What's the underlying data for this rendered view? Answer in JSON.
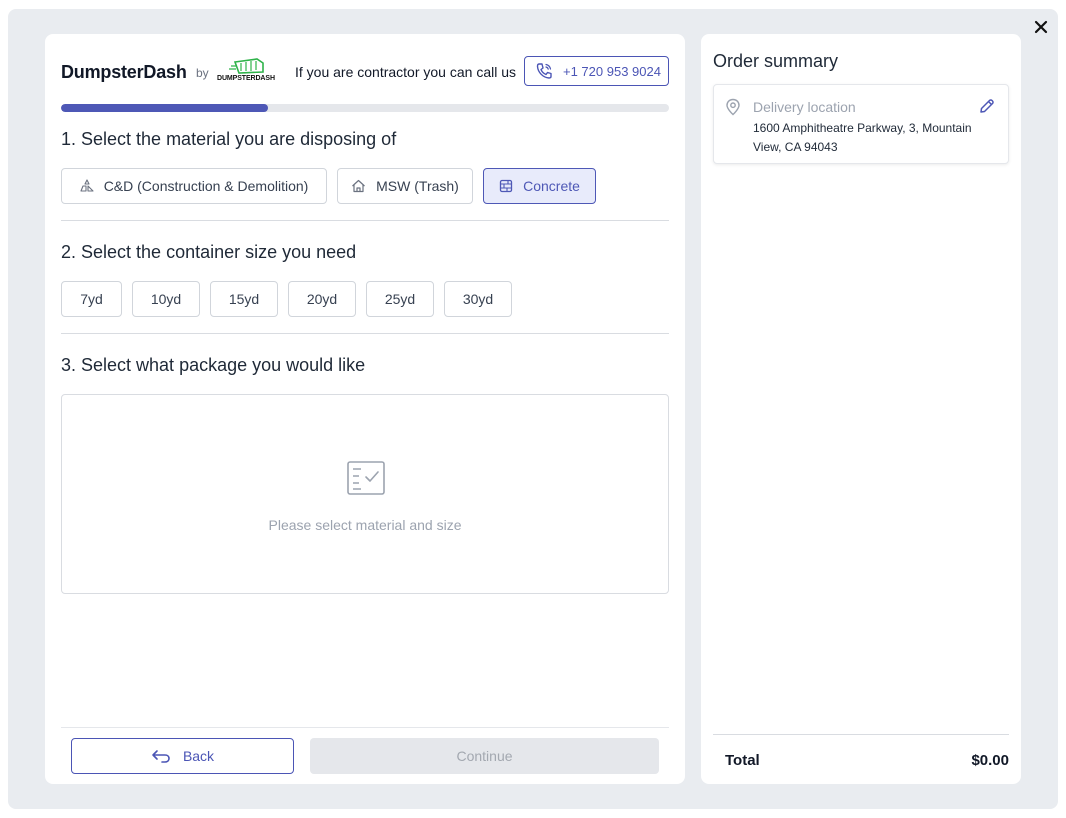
{
  "header": {
    "brand": "DumpsterDash",
    "by": "by",
    "logo_text": "DUMPSTERDASH",
    "contractor_text": "If you are contractor you can call us",
    "phone": "+1 720 953 9024"
  },
  "progress": {
    "fraction": 0.34
  },
  "steps": {
    "material": {
      "title": "1. Select the material you are disposing of",
      "options": [
        {
          "label": "C&D (Construction & Demolition)",
          "icon": "construction-icon",
          "selected": false
        },
        {
          "label": "MSW (Trash)",
          "icon": "house-icon",
          "selected": false
        },
        {
          "label": "Concrete",
          "icon": "concrete-icon",
          "selected": true
        }
      ]
    },
    "size": {
      "title": "2. Select the container size you need",
      "options": [
        "7yd",
        "10yd",
        "15yd",
        "20yd",
        "25yd",
        "30yd"
      ]
    },
    "package": {
      "title": "3. Select what package you would like",
      "empty_text": "Please select material and size",
      "icon": "checklist-icon"
    }
  },
  "buttons": {
    "back": "Back",
    "continue": "Continue"
  },
  "summary": {
    "title": "Order summary",
    "location_label": "Delivery location",
    "address": "1600 Amphitheatre Parkway, 3, Mountain View, CA 94043",
    "total_label": "Total",
    "total_value": "$0.00"
  },
  "colors": {
    "accent": "#4e58b6",
    "backdrop": "#e9ecf0",
    "selected_bg": "#e8ebfb",
    "disabled": "#e5e7eb"
  }
}
